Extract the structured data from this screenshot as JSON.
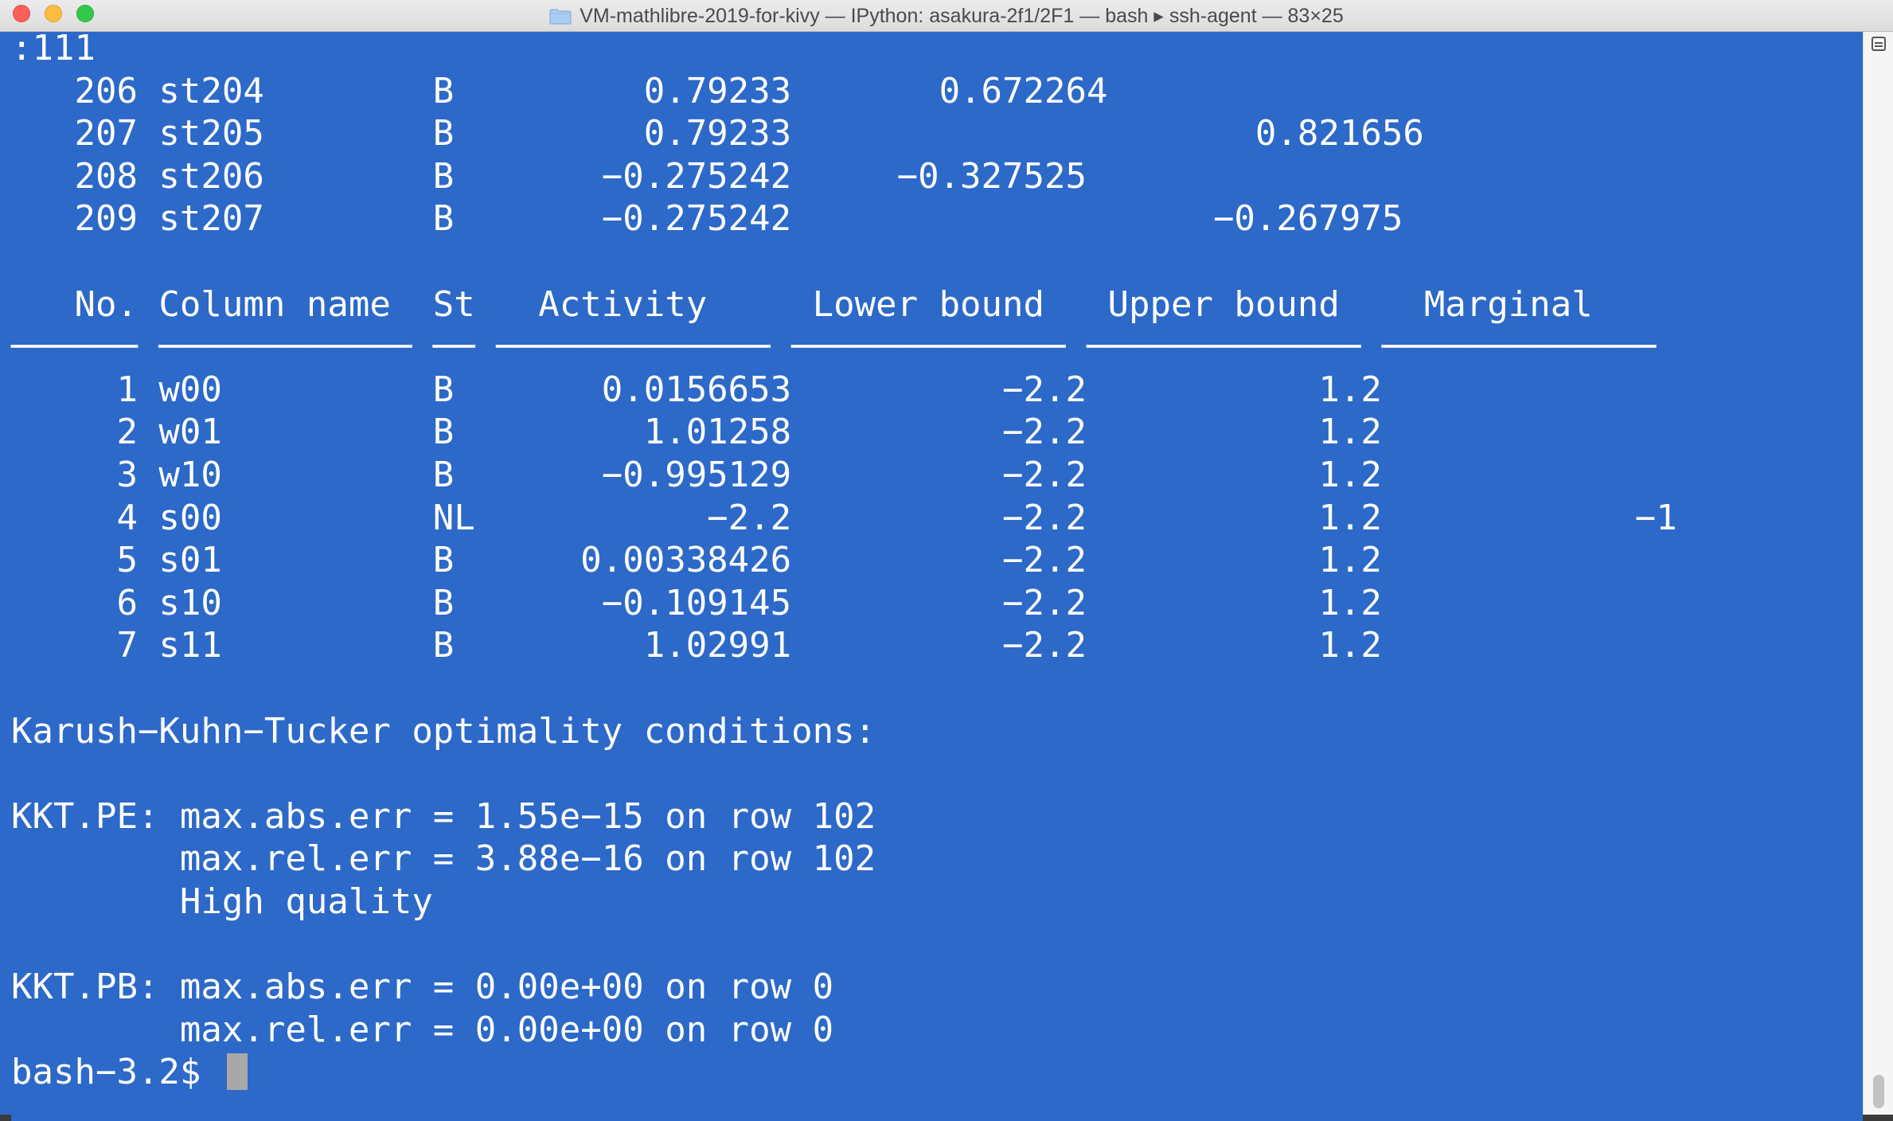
{
  "window": {
    "title": "VM-mathlibre-2019-for-kivy — IPython: asakura-2f1/2F1 — bash ▸ ssh-agent — 83×25",
    "folder_icon": "folder-icon",
    "background_color": "#2c69c8",
    "text_color": "#ffffff"
  },
  "terminal": {
    "lines": [
      ":111",
      "   206 st204        B         0.79233       0.672264",
      "   207 st205        B         0.79233                      0.821656",
      "   208 st206        B       −0.275242     −0.327525",
      "   209 st207        B       −0.275242                    −0.267975",
      "",
      "   No. Column name  St   Activity     Lower bound   Upper bound    Marginal",
      "────── ──────────── ── ───────────── ───────────── ───────────── ─────────────",
      "     1 w00          B       0.0156653          −2.2           1.2",
      "     2 w01          B         1.01258          −2.2           1.2",
      "     3 w10          B       −0.995129          −2.2           1.2",
      "     4 s00          NL           −2.2          −2.2           1.2            −1",
      "     5 s01          B      0.00338426          −2.2           1.2",
      "     6 s10          B       −0.109145          −2.2           1.2",
      "     7 s11          B         1.02991          −2.2           1.2",
      "",
      "Karush−Kuhn−Tucker optimality conditions:",
      "",
      "KKT.PE: max.abs.err = 1.55e−15 on row 102",
      "        max.rel.err = 3.88e−16 on row 102",
      "        High quality",
      "",
      "KKT.PB: max.abs.err = 0.00e+00 on row 0",
      "        max.rel.err = 0.00e+00 on row 0"
    ],
    "prompt": "bash−3.2$ "
  }
}
